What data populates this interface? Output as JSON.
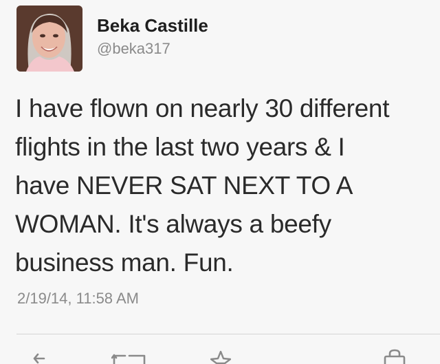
{
  "tweet": {
    "author": {
      "display_name": "Beka Castille",
      "handle": "@beka317"
    },
    "text_lines": [
      "I have flown on nearly 30 different",
      "flights in the last two years & I",
      "have NEVER SAT NEXT TO A",
      "WOMAN. It's always a beefy",
      "business man. Fun."
    ],
    "timestamp": "2/19/14, 11:58 AM"
  },
  "actions": {
    "icons": [
      "reply-icon",
      "retweet-icon",
      "favorite-icon",
      "share-icon"
    ]
  },
  "colors": {
    "background": "#f7f7f7",
    "text": "#2a2a2a",
    "secondary_text": "#8a8a8a",
    "divider": "#d4d4d4"
  }
}
